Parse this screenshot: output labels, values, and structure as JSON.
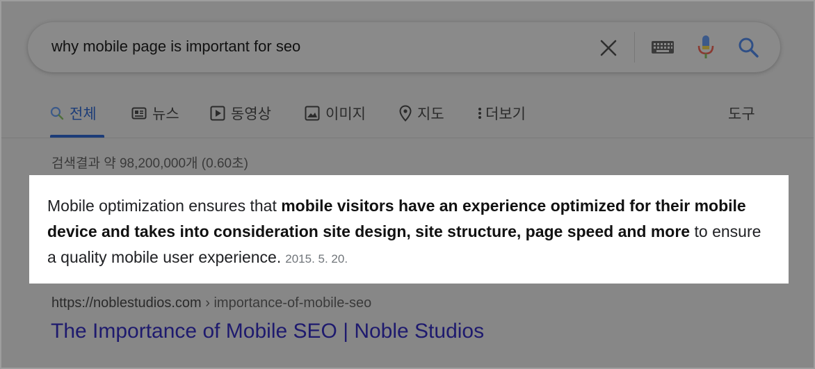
{
  "search": {
    "query": "why mobile page is important for seo",
    "icons": [
      "close-icon",
      "keyboard-icon",
      "mic-icon",
      "search-icon"
    ]
  },
  "tabs": [
    {
      "label": "전체",
      "icon": "search-icon",
      "active": true
    },
    {
      "label": "뉴스",
      "icon": "news-icon"
    },
    {
      "label": "동영상",
      "icon": "video-icon"
    },
    {
      "label": "이미지",
      "icon": "image-icon"
    },
    {
      "label": "지도",
      "icon": "map-pin-icon"
    },
    {
      "label": "더보기",
      "icon": "more-vert-icon"
    }
  ],
  "tools_label": "도구",
  "result_stats": "검색결과 약 98,200,000개 (0.60초)",
  "snippet": {
    "text_1": "Mobile optimization ensures that ",
    "bold_1": "mobile visitors have an experience optimized for their mobile device and takes into consideration site design, site structure, page speed and more",
    "text_2": " to ensure a quality mobile user experience.",
    "date": "2015. 5. 20."
  },
  "result": {
    "domain": "https://noblestudios.com",
    "path": " › importance-of-mobile-seo",
    "title": "The Importance of Mobile SEO | Noble Studios"
  },
  "colors": {
    "overlay": "#878787",
    "link_title": "#1e1a6e",
    "active_tab": "#1c3c78",
    "mic_blue": "#3c5a8a",
    "mic_red": "#8a3a32"
  }
}
